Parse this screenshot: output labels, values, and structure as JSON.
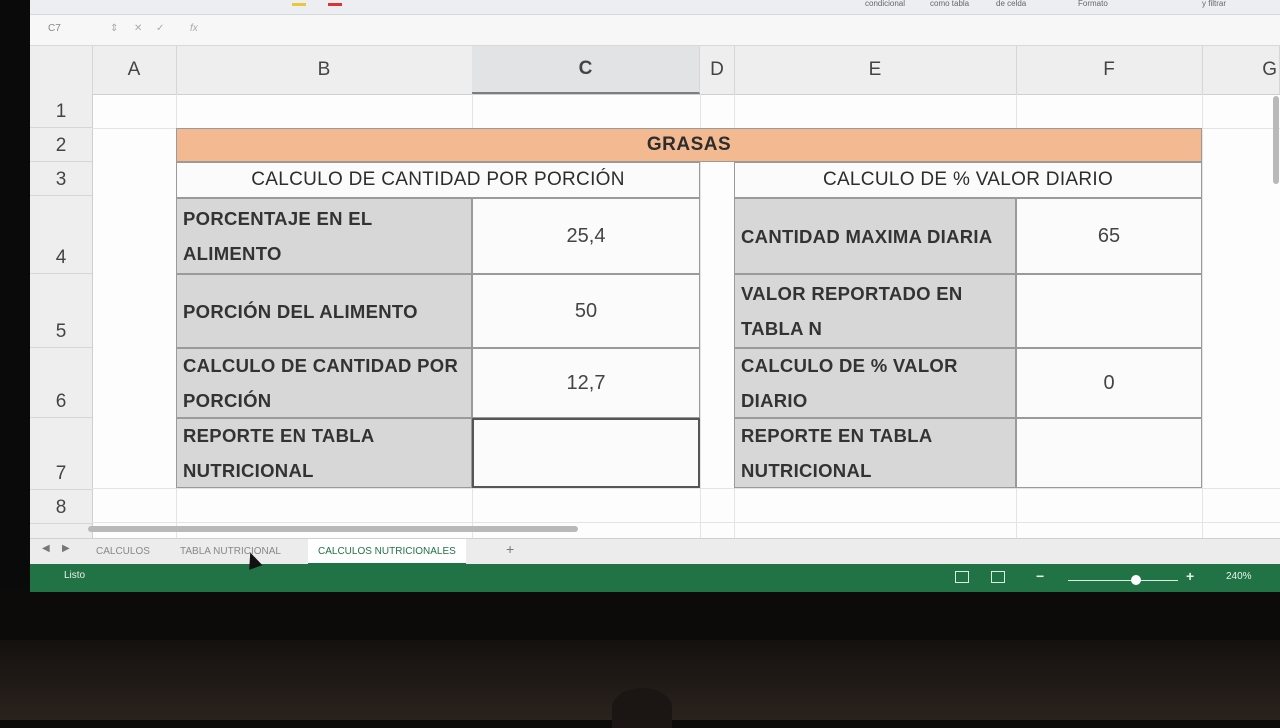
{
  "ribbon": {
    "items": [
      "condicional",
      "como tabla",
      "de celda",
      "Formato",
      "y filtrar"
    ]
  },
  "formula_bar": {
    "cell_ref": "C7",
    "fx": "fx"
  },
  "columns": [
    "A",
    "B",
    "C",
    "D",
    "E",
    "F"
  ],
  "selected_column": "C",
  "rows": [
    "1",
    "2",
    "3",
    "4",
    "5",
    "6",
    "7",
    "8"
  ],
  "table": {
    "title": "GRASAS",
    "left": {
      "header": "CALCULO DE CANTIDAD POR PORCIÓN",
      "rows": [
        {
          "label": "PORCENTAJE EN EL ALIMENTO",
          "value": "25,4"
        },
        {
          "label": "PORCIÓN DEL ALIMENTO",
          "value": "50"
        },
        {
          "label": "CALCULO DE CANTIDAD POR PORCIÓN",
          "value": "12,7"
        },
        {
          "label": "REPORTE EN TABLA NUTRICIONAL",
          "value": ""
        }
      ]
    },
    "right": {
      "header": "CALCULO DE % VALOR DIARIO",
      "rows": [
        {
          "label": "CANTIDAD MAXIMA DIARIA",
          "value": "65"
        },
        {
          "label": "VALOR REPORTADO EN TABLA N",
          "value": ""
        },
        {
          "label": "CALCULO DE % VALOR DIARIO",
          "value": "0"
        },
        {
          "label": "REPORTE EN TABLA NUTRICIONAL",
          "value": ""
        }
      ]
    }
  },
  "sheets": {
    "tabs": [
      "CALCULOS",
      "TABLA NUTRICIONAL",
      "CALCULOS NUTRICIONALES"
    ],
    "active": "CALCULOS NUTRICIONALES",
    "add_label": "+"
  },
  "status": {
    "text": "Listo",
    "zoom": "240%",
    "zoom_fraction": 0.6
  },
  "colors": {
    "banner": "#f3b990",
    "label_fill": "#d7d7d7",
    "status_bar": "#217346"
  }
}
